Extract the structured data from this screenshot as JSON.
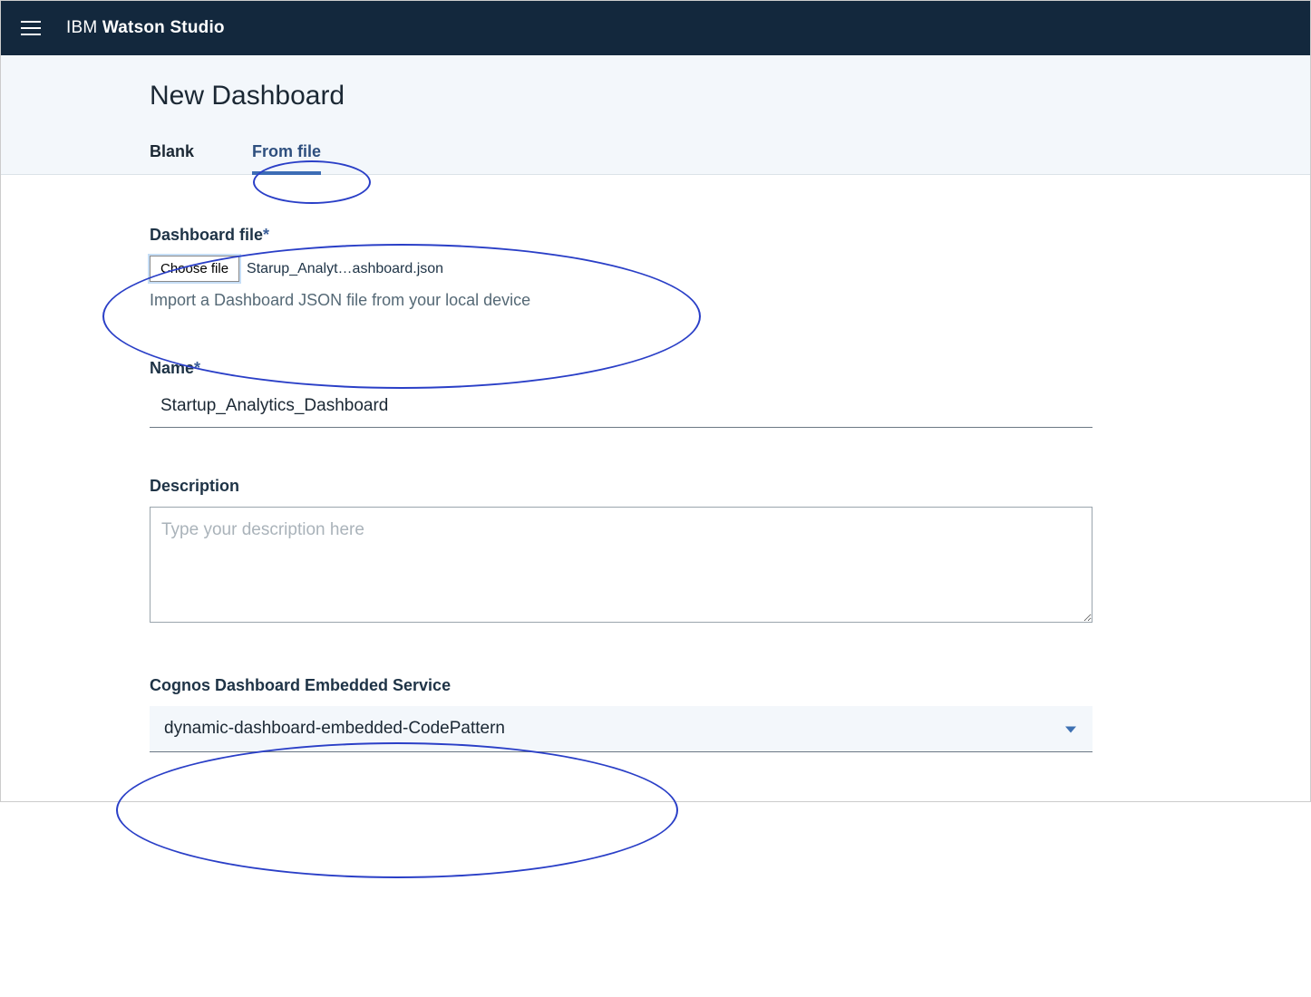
{
  "brand": {
    "prefix": "IBM ",
    "name": "Watson Studio"
  },
  "page": {
    "title": "New Dashboard"
  },
  "tabs": {
    "blank": "Blank",
    "from_file": "From file"
  },
  "dashboard_file": {
    "label": "Dashboard file",
    "required_mark": "*",
    "choose_button": "Choose file",
    "selected_file": "Starup_Analyt…ashboard.json",
    "hint": "Import a Dashboard JSON file from your local device"
  },
  "name_field": {
    "label": "Name",
    "required_mark": "*",
    "value": "Startup_Analytics_Dashboard"
  },
  "description_field": {
    "label": "Description",
    "placeholder": "Type your description here",
    "value": ""
  },
  "cognos_field": {
    "label": "Cognos Dashboard Embedded Service",
    "value": "dynamic-dashboard-embedded-CodePattern"
  }
}
